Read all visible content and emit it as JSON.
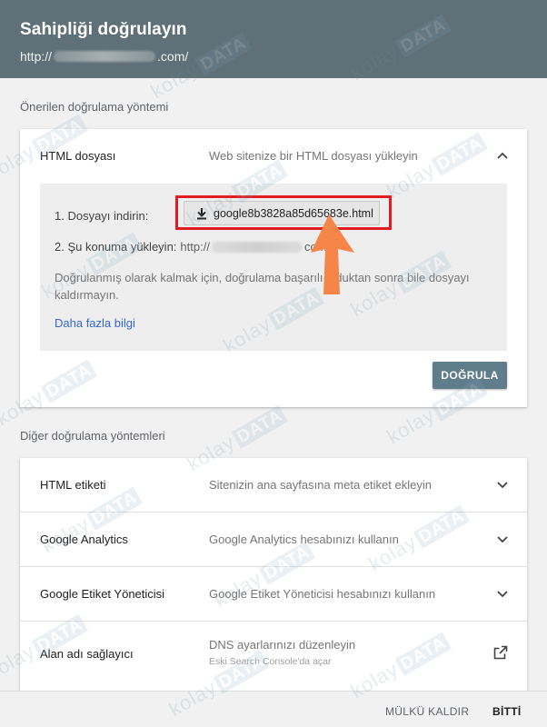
{
  "header": {
    "title": "Sahipliği doğrulayın",
    "url_prefix": "http://",
    "url_suffix": ".com/"
  },
  "recommended_label": "Önerilen doğrulama yöntemi",
  "html_file": {
    "name": "HTML dosyası",
    "description": "Web sitenize bir HTML dosyası yükleyin",
    "step1_label": "1. Dosyayı indirin:",
    "download_filename": "google8b3828a85d65683e.html",
    "step2_label": "2. Şu konuma yükleyin:",
    "step2_path_prefix": "http://",
    "step2_path_suffix": "com",
    "note": "Doğrulanmış olarak kalmak için, doğrulama başarılı olduktan sonra bile dosyayı kaldırmayın.",
    "more_link": "Daha fazla bilgi",
    "verify_button": "DOĞRULA"
  },
  "other_label": "Diğer doğrulama yöntemleri",
  "other_methods": [
    {
      "name": "HTML etiketi",
      "description": "Sitenizin ana sayfasına meta etiket ekleyin",
      "icon": "chevron-down-icon"
    },
    {
      "name": "Google Analytics",
      "description": "Google Analytics hesabınızı kullanın",
      "icon": "chevron-down-icon"
    },
    {
      "name": "Google Etiket Yöneticisi",
      "description": "Google Etiket Yöneticisi hesabınızı kullanın",
      "icon": "chevron-down-icon"
    },
    {
      "name": "Alan adı sağlayıcı",
      "description": "DNS ayarlarınızı düzenleyin",
      "subtext": "Eski Search Console'da açar",
      "icon": "open-in-new-icon"
    }
  ],
  "footer": {
    "remove_button": "MÜLKÜ KALDIR",
    "done_button": "BİTTİ"
  },
  "watermark": {
    "brand": "kolay",
    "badge": "DATA"
  },
  "colors": {
    "header_bg": "#5f7078",
    "verify_button_bg": "#607d8b",
    "highlight_border": "#e31b23",
    "pointer_arrow": "#f58549",
    "link": "#3367d6"
  }
}
